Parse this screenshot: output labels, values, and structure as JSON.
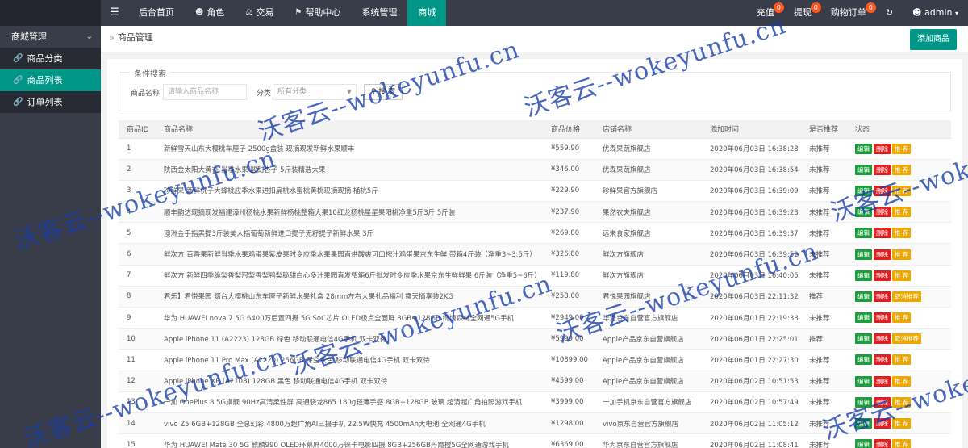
{
  "topbar": {
    "menu_icon": "menu-icon",
    "nav": [
      {
        "label": "后台首页",
        "icon": ""
      },
      {
        "label": "角色",
        "icon": "user-icon"
      },
      {
        "label": "交易",
        "icon": "scale-icon"
      },
      {
        "label": "帮助中心",
        "icon": "flag-icon"
      },
      {
        "label": "系统管理",
        "icon": ""
      },
      {
        "label": "商城",
        "icon": "",
        "active": true
      }
    ],
    "right": [
      {
        "label": "充值",
        "badge": "0"
      },
      {
        "label": "提现",
        "badge": "0"
      },
      {
        "label": "购物订单",
        "badge": "0"
      }
    ],
    "refresh_icon": "refresh-icon",
    "user": "admin"
  },
  "sidebar": {
    "group": "商城管理",
    "items": [
      {
        "label": "商品分类",
        "active": false
      },
      {
        "label": "商品列表",
        "active": true
      },
      {
        "label": "订单列表",
        "active": false
      }
    ]
  },
  "main": {
    "breadcrumb": "商品管理",
    "add_button": "添加商品",
    "search": {
      "legend": "条件搜索",
      "name_label": "商品名称",
      "name_placeholder": "请输入商品名称",
      "cat_label": "分类",
      "cat_value": "所有分类",
      "button": "搜 索"
    },
    "table": {
      "headers": [
        "商品ID",
        "商品名称",
        "商品价格",
        "店铺名称",
        "添加时间",
        "是否推荐",
        "状态"
      ],
      "edit_label": "编辑",
      "delete_label": "删除",
      "recommend_label": "推 荐",
      "unrecommend_label": "取消推荐",
      "rows": [
        {
          "id": "1",
          "name": "新鲜雪天山东大樱桃车厘子 2500g盒装 现摘现发新鲜水果顺丰",
          "price": "¥559.90",
          "shop": "优森果蔬旗舰店",
          "time": "2020年06月03日 16:38:28",
          "rec": "未推荐"
        },
        {
          "id": "2",
          "name": "陕西金太阳大黄杏 当季水果 酸甜杏子 5斤装精选大果",
          "price": "¥346.00",
          "shop": "优森果蔬旗舰店",
          "time": "2020年06月03日 16:38:54",
          "rec": "未推荐"
        },
        {
          "id": "3",
          "name": "珍鲜果 新鲜桃子大蜂桃应季水果进扣扁桃水蜜桃黄桃现摘现摘 桶桃5斤",
          "price": "¥229.90",
          "shop": "珍鲜果官方旗舰店",
          "time": "2020年06月03日 16:39:09",
          "rec": "未推荐"
        },
        {
          "id": "4",
          "name": "顺丰韵达现摘现发福建漳州杨桃水果新鲜杨桃整箱大果10红龙杨桃星星果阳桃净重5斤3斤 5斤装",
          "price": "¥237.90",
          "shop": "果然农夫旗舰店",
          "time": "2020年06月03日 16:39:23",
          "rec": "未推荐"
        },
        {
          "id": "5",
          "name": "澳洲金手指黑提3斤装美人指葡萄新鲜进口提子无籽提子新鲜水果 3斤",
          "price": "¥269.80",
          "shop": "远来食家旗舰店",
          "time": "2020年06月03日 16:39:37",
          "rec": "未推荐"
        },
        {
          "id": "6",
          "name": "鲜次方 百香果新鲜当季水果鸡蛋果紫皮果时令应季水果果园直供酸爽可口榨汁鸡蛋果京东生鲜 带箱4斤装（净重3~3.5斤）",
          "price": "¥326.80",
          "shop": "鲜次方旗舰店",
          "time": "2020年06月03日 16:39:52",
          "rec": "未推荐"
        },
        {
          "id": "7",
          "name": "鲜次方 新鲜四季脆梨香梨冠梨香梨鸭梨脆甜白心多汁果园直发整箱6斤批发时令应季水果京东生鲜鲜果 6斤装（净重5~6斤）",
          "price": "¥119.80",
          "shop": "鲜次方旗舰店",
          "time": "2020年06月03日 16:40:05",
          "rec": "未推荐"
        },
        {
          "id": "8",
          "name": "君乐】君悦果园 烟台大樱桃山东车厘子新鲜水果礼盒 28mm左右大果礼品福利 露天摘享装2KG",
          "price": "¥258.00",
          "shop": "君悦果园旗舰店",
          "time": "2020年06月03日 22:11:32",
          "rec": "推荐"
        },
        {
          "id": "9",
          "name": "华为 HUAWEI nova 7 5G 6400万后置四摄 5G SoC芯片 OLED极点全面屏 8GB+128GB 绮境森林全网通5G手机",
          "price": "¥2949.00",
          "shop": "华为京东自营官方旗舰店",
          "time": "2020年06月01日 22:19:38",
          "rec": "未推荐"
        },
        {
          "id": "10",
          "name": "Apple iPhone 11 (A2223) 128GB 绿色 移动联通电信4G手机 双卡双待",
          "price": "¥5999.00",
          "shop": "Apple产品京东自营旗舰店",
          "time": "2020年06月01日 22:25:01",
          "rec": "推荐"
        },
        {
          "id": "11",
          "name": "Apple iPhone 11 Pro Max (A2220) 256GB 深空灰色 移动联通电信4G手机 双卡双待",
          "price": "¥10899.00",
          "shop": "Apple产品京东自营旗舰店",
          "time": "2020年06月01日 22:27:30",
          "rec": "未推荐"
        },
        {
          "id": "12",
          "name": "Apple iPhone XR (A2108) 128GB 黑色 移动联通电信4G手机 双卡双待",
          "price": "¥4599.00",
          "shop": "Apple产品京东自营旗舰店",
          "time": "2020年06月02日 10:51:53",
          "rec": "未推荐"
        },
        {
          "id": "13",
          "name": "一加 OnePlus 8 5G旗舰 90Hz高清柔性屏 高通骁龙865 180g轻薄手感 8GB+128GB 玻璃 超清超广角拍照游戏手机",
          "price": "¥3999.00",
          "shop": "一加手机京东自营官方旗舰店",
          "time": "2020年06月02日 10:57:49",
          "rec": "未推荐"
        },
        {
          "id": "14",
          "name": "vivo Z5 6GB+128GB 全息幻彩 4800万超广角AI三摄手机 22.5W快充 4500mAh大电池 全网通4G手机",
          "price": "¥1298.00",
          "shop": "vivo京东自营官方旗舰店",
          "time": "2020年06月02日 11:05:12",
          "rec": "未推荐"
        },
        {
          "id": "15",
          "name": "华为 HUAWEI Mate 30 5G 麒麟990 OLED环幕屏4000万徕卡电影四摄 8GB+256GB丹霞橙5G全网通游戏手机",
          "price": "¥6369.00",
          "shop": "华为京东自营官方旗舰店",
          "time": "2020年06月02日 11:08:41",
          "rec": "未推荐"
        }
      ]
    }
  },
  "watermark": "沃客云--wokeyunfu.cn"
}
